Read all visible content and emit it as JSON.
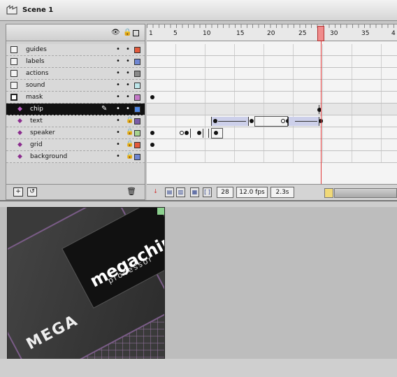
{
  "scene": {
    "label": "Scene 1"
  },
  "colors": {
    "guides": "#e35a3c",
    "labels": "#6f86d2",
    "actions": "#8a8a8a",
    "sound": "#bde6ea",
    "mask": "#c479c8",
    "chip": "#4f86e3",
    "text": "#7a5ca8",
    "speaker": "#a7d38f",
    "grid": "#e35a3c",
    "background": "#6f86d2"
  },
  "ruler": {
    "ticks": [
      "1",
      "5",
      "10",
      "15",
      "20",
      "25",
      "30",
      "35",
      "4"
    ]
  },
  "layers": [
    {
      "name": "guides",
      "type": "folder"
    },
    {
      "name": "labels",
      "type": "folder"
    },
    {
      "name": "actions",
      "type": "folder"
    },
    {
      "name": "sound",
      "type": "folder"
    },
    {
      "name": "mask",
      "type": "mask"
    },
    {
      "name": "chip",
      "type": "diamond",
      "selected": true
    },
    {
      "name": "text",
      "type": "diamond"
    },
    {
      "name": "speaker",
      "type": "diamond"
    },
    {
      "name": "grid",
      "type": "diamond"
    },
    {
      "name": "background",
      "type": "diamond"
    }
  ],
  "footer": {
    "current_frame": "28",
    "frame_rate": "12.0 fps",
    "elapsed": "2.3s"
  },
  "artwork": {
    "brand": "megachip",
    "sub": "processor",
    "mega": "MEGA"
  }
}
